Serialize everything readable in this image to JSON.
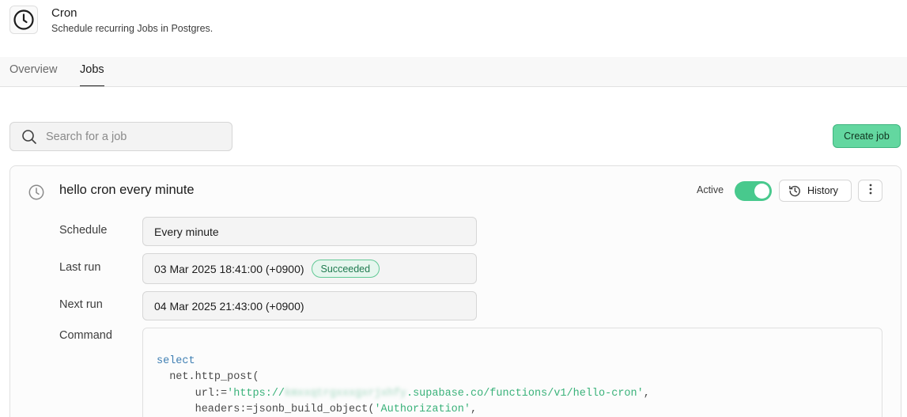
{
  "header": {
    "icon": "clock-icon",
    "title": "Cron",
    "subtitle": "Schedule recurring Jobs in Postgres."
  },
  "tabs": [
    {
      "label": "Overview",
      "active": false
    },
    {
      "label": "Jobs",
      "active": true
    }
  ],
  "search": {
    "placeholder": "Search for a job",
    "value": ""
  },
  "toolbar": {
    "create_label": "Create job"
  },
  "job": {
    "icon": "clock-icon",
    "name": "hello cron every minute",
    "active_label": "Active",
    "active": true,
    "history_label": "History",
    "schedule_label": "Schedule",
    "schedule_value": "Every minute",
    "last_run_label": "Last run",
    "last_run_value": "03 Mar 2025 18:41:00 (+0900)",
    "last_run_status": "Succeeded",
    "next_run_label": "Next run",
    "next_run_value": "04 Mar 2025 21:43:00 (+0900)",
    "command_label": "Command",
    "command": {
      "l1_kw": "select",
      "l2_fn": "  net.http_post(",
      "l3_prefix": "      url:=",
      "l3_str_start": "'https://",
      "l3_blurred": "kmxxqtrgxxxgxrjxhfy",
      "l3_str_end": ".supabase.co/functions/v1/hello-cron'",
      "l3_suffix": ",",
      "l4_prefix": "      headers:=jsonb_build_object(",
      "l4_str": "'Authorization'",
      "l4_suffix": ","
    }
  },
  "colors": {
    "accent": "#48c98d",
    "create_button": "#63d7a0",
    "keyword": "#3f7fb3",
    "string": "#3ab27a"
  }
}
